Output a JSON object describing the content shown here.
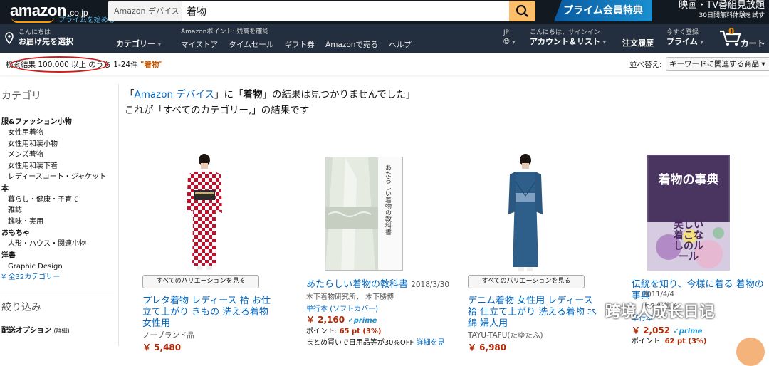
{
  "header": {
    "logo_text": "amazon",
    "logo_domain": ".co.jp",
    "logo_prime": "プライムを始める",
    "search_category": "Amazon デバイス",
    "search_value": "着物",
    "prime_banner": "プライム会員特典",
    "promo_title": "映画・TV番組見放題",
    "promo_sub": "30日間無料体験を試す"
  },
  "nav": {
    "address_small": "こんにちは",
    "address_big": "お届け先を選択",
    "category": "カテゴリー",
    "points": "Amazonポイント: 残高を確認",
    "links": [
      "マイストア",
      "タイムセール",
      "ギフト券",
      "Amazonで売る",
      "ヘルプ"
    ],
    "lang": "JP",
    "account_small": "こんにちは、サインイン",
    "account_big": "アカウント＆リスト",
    "orders": "注文履歴",
    "prime_small": "今すぐ登録",
    "prime_big": "プライム",
    "cart_count": "0",
    "cart_label": "カート"
  },
  "results": {
    "summary": "検索結果 100,000 以上 のうち 1-24件",
    "query": "\"着物\"",
    "sort_label": "並べ替え:",
    "sort_value": "キーワードに関連する商品"
  },
  "sidebar": {
    "category_heading": "カテゴリ",
    "groups": [
      {
        "title": "服&ファッション小物",
        "items": [
          "女性用着物",
          "女性用和装小物",
          "メンズ着物",
          "女性用和装下着",
          "レディースコート・ジャケット"
        ]
      },
      {
        "title": "本",
        "items": [
          "暮らし・健康・子育て",
          "雑誌",
          "趣味・実用"
        ]
      },
      {
        "title": "おもちゃ",
        "items": [
          "人形・ハウス・関連小物"
        ]
      },
      {
        "title": "洋書",
        "items": [
          "Graphic Design"
        ]
      }
    ],
    "all_categories": "全32カテゴリー",
    "refine_heading": "絞り込み",
    "shipping_option": "配送オプション",
    "shipping_detail": "(詳細)"
  },
  "message": {
    "line1_q1": "「",
    "line1_store": "Amazon デバイス",
    "line1_mid": "」に「",
    "line1_query": "着物",
    "line1_end": "」の結果は見つかりませんでした」",
    "line2": "これが「すべてのカテゴリー,」の結果です"
  },
  "products": [
    {
      "variations": "すべてのバリエーションを見る",
      "title": "プレタ着物 レディース 袷 お仕立て上がり きもの 洗える着物 女性用",
      "brand": "ノーブランド品",
      "price": "￥ 5,480"
    },
    {
      "title": "あたらしい着物の教科書",
      "date": "2018/3/30",
      "author": "木下着物研究所、 木下勝博",
      "format": "単行本 (ソフトカバー)",
      "price": "￥ 2,160",
      "prime": "✓prime",
      "points_label": "ポイント:",
      "points": "65 pt (3%)",
      "note": "まとめ買いで日用品等が30%OFF",
      "note_link": "詳細を見"
    },
    {
      "variations": "すべてのバリエーションを見る",
      "title": "デニム着物 女性用 レディース 袷 仕立て上がり 洗える着物 木綿 婦人用",
      "brand": "TAYU-TAFU(たゆたふ)",
      "price": "￥ 6,980"
    },
    {
      "title": "伝統を知り、今様に着る 着物の事典",
      "date": "2011/4/4",
      "author": "大久保信子",
      "format": "単行本",
      "price": "￥ 2,052",
      "prime": "✓prime",
      "points_label": "ポイント:",
      "points": "62 pt (3%)"
    }
  ],
  "book_covers": {
    "book1_title": "あたらしい着物の教科書",
    "book2_title": "着物の事典",
    "book2_sub": "美しい着こなしのルール"
  },
  "watermark": "跨境人成长日记"
}
